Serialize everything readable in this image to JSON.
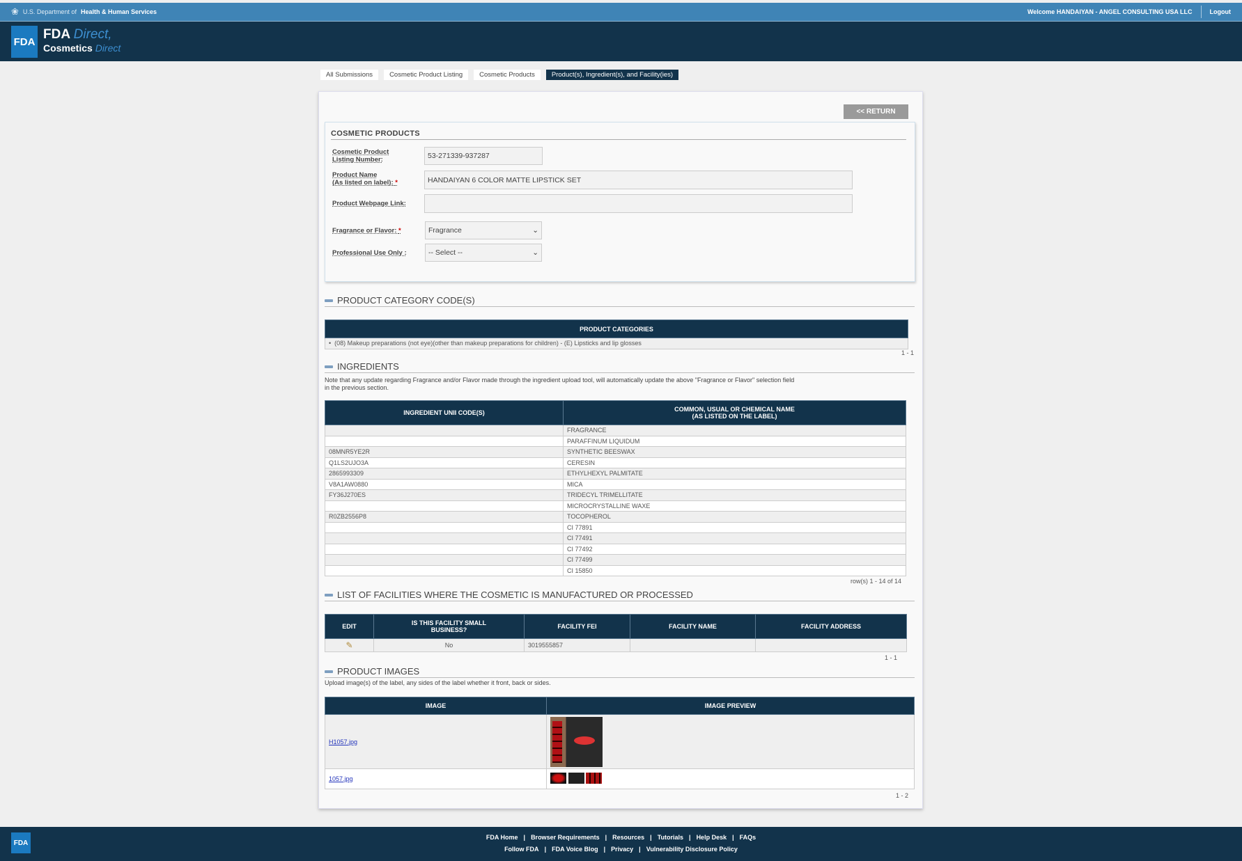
{
  "topbar": {
    "hhs": "U.S. Department of",
    "hhs_bold": "Health & Human Services",
    "welcome": "Welcome HANDAIYAN - ANGEL CONSULTING USA LLC",
    "logout": "Logout"
  },
  "header": {
    "logo": "FDA",
    "brand_fda": "FDA",
    "brand_direct": "Direct,",
    "brand_cosmetics": "Cosmetics",
    "brand_direct2": "Direct"
  },
  "breadcrumb": [
    "All Submissions",
    "Cosmetic Product Listing",
    "Cosmetic Products",
    "Product(s), Ingredient(s), and Facility(ies)"
  ],
  "return_label": "<< RETURN",
  "cosmetic_products": {
    "title": "COSMETIC PRODUCTS",
    "listing_label1": "Cosmetic Product",
    "listing_label2": "Listing Number:",
    "listing_value": "53-271339-937287",
    "name_label1": "Product Name",
    "name_label2": "(As listed on label):",
    "name_value": "HANDAIYAN 6 COLOR MATTE LIPSTICK SET",
    "webpage_label": "Product Webpage Link:",
    "webpage_value": "",
    "fragrance_label": "Fragrance or Flavor:",
    "fragrance_value": "Fragrance",
    "professional_label": "Professional Use Only :",
    "professional_value": "-- Select --",
    "required": "*"
  },
  "categories": {
    "title": "PRODUCT CATEGORY CODE(S)",
    "header": "PRODUCT CATEGORIES",
    "items": [
      "(08) Makeup preparations (not eye)(other than makeup preparations for children) - (E) Lipsticks and lip glosses"
    ],
    "pager": "1 - 1"
  },
  "ingredients": {
    "title": "INGREDIENTS",
    "note1": "Note that any update regarding Fragrance and/or Flavor made through the ingredient upload tool, will automatically update the above \"Fragrance or Flavor\" selection field",
    "note2": "in the previous section.",
    "col1": "INGREDIENT UNII CODE(S)",
    "col2a": "COMMON, USUAL OR CHEMICAL NAME",
    "col2b": "(AS LISTED ON THE LABEL)",
    "rows": [
      [
        "",
        "FRAGRANCE"
      ],
      [
        "",
        "PARAFFINUM LIQUIDUM"
      ],
      [
        "08MNR5YE2R",
        "SYNTHETIC BEESWAX"
      ],
      [
        "Q1LS2UJO3A",
        "CERESIN"
      ],
      [
        "2865993309",
        "ETHYLHEXYL PALMITATE"
      ],
      [
        "V8A1AW0880",
        "MICA"
      ],
      [
        "FY36J270ES",
        "TRIDECYL TRIMELLITATE"
      ],
      [
        "",
        "MICROCRYSTALLINE WAXE"
      ],
      [
        "R0ZB2556P8",
        "TOCOPHEROL"
      ],
      [
        "",
        "CI 77891"
      ],
      [
        "",
        "CI 77491"
      ],
      [
        "",
        "CI 77492"
      ],
      [
        "",
        "CI 77499"
      ],
      [
        "",
        "CI 15850"
      ]
    ],
    "pager": "row(s) 1 - 14 of 14"
  },
  "facilities": {
    "title": "LIST OF FACILITIES WHERE THE COSMETIC IS MANUFACTURED OR PROCESSED",
    "cols": [
      "EDIT",
      "IS THIS FACILITY SMALL BUSINESS?",
      "FACILITY FEI",
      "FACILITY NAME",
      "FACILITY ADDRESS"
    ],
    "rows": [
      {
        "small_business": "No",
        "fei": "3019555857",
        "name": "",
        "address": ""
      }
    ],
    "pager": "1 - 1"
  },
  "images": {
    "title": "PRODUCT IMAGES",
    "note": "Upload image(s) of the label, any sides of the label whether it front, back or sides.",
    "col1": "IMAGE",
    "col2": "IMAGE PREVIEW",
    "rows": [
      {
        "file": "H1057.jpg"
      },
      {
        "file": "1057.jpg"
      }
    ],
    "pager": "1 - 2"
  },
  "footer": {
    "logo": "FDA",
    "row1": [
      "FDA Home",
      "Browser Requirements",
      "Resources",
      "Tutorials",
      "Help Desk",
      "FAQs"
    ],
    "row2": [
      "Follow FDA",
      "FDA Voice Blog",
      "Privacy",
      "Vulnerability Disclosure Policy"
    ]
  }
}
